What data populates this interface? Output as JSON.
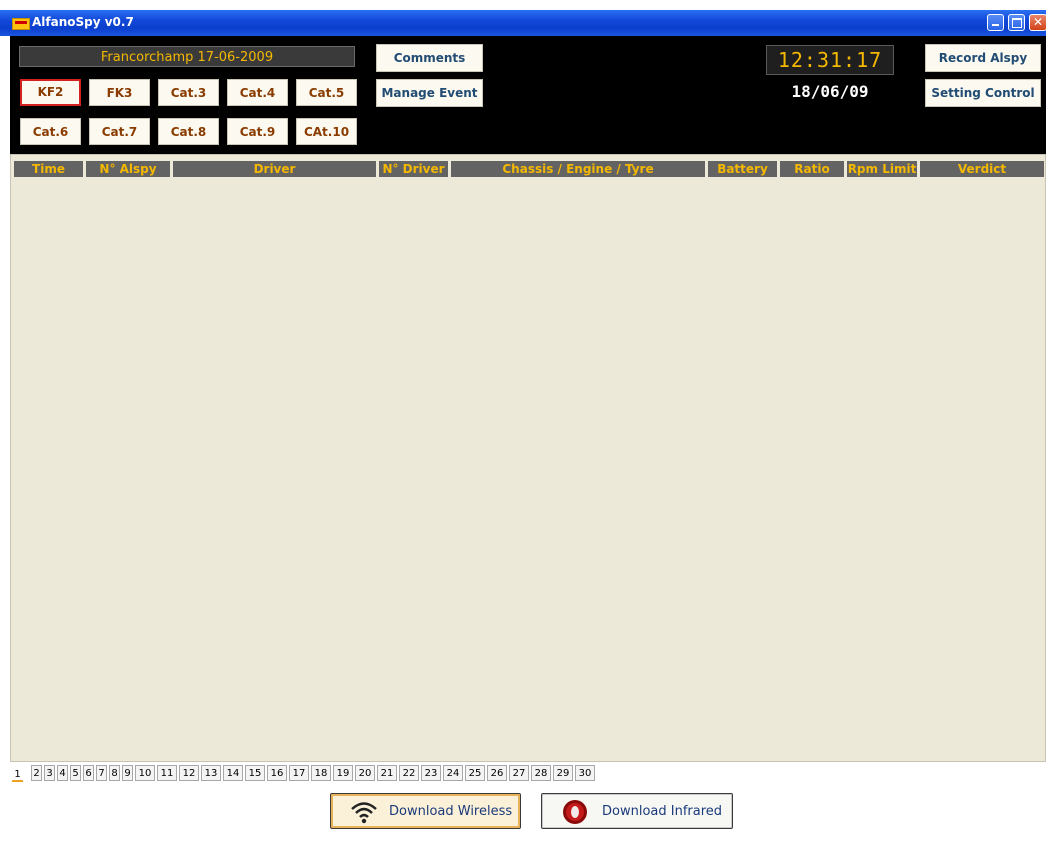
{
  "window": {
    "title": "AlfanoSpy v0.7"
  },
  "event": {
    "name": "Francorchamp 17-06-2009"
  },
  "categories": [
    {
      "label": "KF2",
      "active": true
    },
    {
      "label": "FK3"
    },
    {
      "label": "Cat.3"
    },
    {
      "label": "Cat.4"
    },
    {
      "label": "Cat.5"
    },
    {
      "label": "Cat.6"
    },
    {
      "label": "Cat.7"
    },
    {
      "label": "Cat.8"
    },
    {
      "label": "Cat.9"
    },
    {
      "label": "CAt.10"
    }
  ],
  "toolbar": {
    "comments": "Comments",
    "manage_event": "Manage Event",
    "record": "Record Alspy",
    "setting_control": "Setting Control"
  },
  "clock": {
    "time": "12:31:17",
    "date": "18/06/09"
  },
  "table": {
    "columns": [
      "Time",
      "N° Alspy",
      "Driver",
      "N° Driver",
      "Chassis / Engine / Tyre",
      "Battery",
      "Ratio",
      "Rpm Limit",
      "Verdict"
    ],
    "rows": []
  },
  "pages": {
    "current": "1",
    "items": [
      "1",
      "2",
      "3",
      "4",
      "5",
      "6",
      "7",
      "8",
      "9",
      "10",
      "11",
      "12",
      "13",
      "14",
      "15",
      "16",
      "17",
      "18",
      "19",
      "20",
      "21",
      "22",
      "23",
      "24",
      "25",
      "26",
      "27",
      "28",
      "29",
      "30"
    ]
  },
  "downloads": {
    "wireless": "Download Wireless",
    "infrared": "Download Infrared"
  },
  "colors": {
    "accent": "#f5b800",
    "titlebar": "#0a3fce",
    "grid_background": "#ece9d8",
    "active_border": "#d32020"
  }
}
